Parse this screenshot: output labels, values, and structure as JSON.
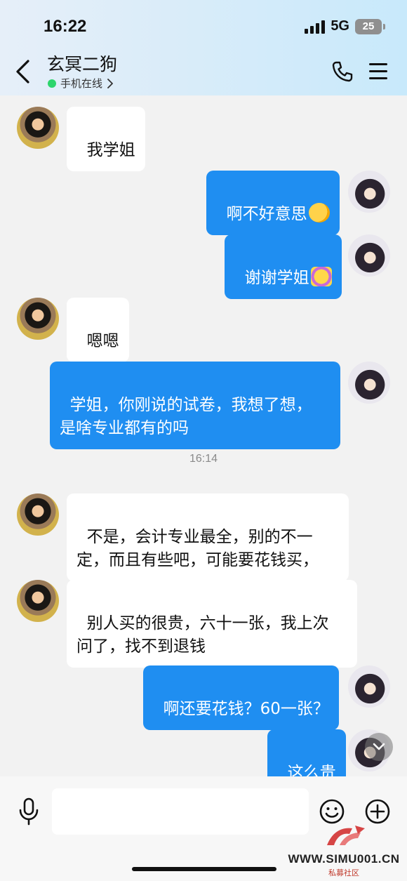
{
  "status_bar": {
    "time": "16:22",
    "network": "5G",
    "battery": "25"
  },
  "header": {
    "contact_name": "玄冥二狗",
    "presence": "手机在线"
  },
  "messages": [
    {
      "side": "in",
      "text": "我学姐"
    },
    {
      "side": "out",
      "text": "啊不好意思",
      "emoji": "laugh-emoji"
    },
    {
      "side": "out",
      "text": "谢谢学姐",
      "emoji": "thanks-emoji"
    },
    {
      "side": "in",
      "text": "嗯嗯"
    },
    {
      "side": "out",
      "text": "学姐，你刚说的试卷，我想了想，\n是啥专业都有的吗"
    },
    {
      "side": "in",
      "text": "不是，会计专业最全，别的不一\n定，而且有些吧，可能要花钱买，"
    },
    {
      "side": "in",
      "text": "别人买的很贵，六十一张，我上次\n问了，找不到退钱"
    },
    {
      "side": "out",
      "text": "啊还要花钱？60一张？"
    },
    {
      "side": "out",
      "text": "这么贵"
    }
  ],
  "timestamp": "16:14",
  "input": {
    "value": "",
    "placeholder": ""
  },
  "watermark": {
    "site": "WWW.SIMU001.CN",
    "subtitle": "私募社区"
  },
  "colors": {
    "outgoing_bubble": "#1f8ef1",
    "incoming_bubble": "#ffffff",
    "online_dot": "#2dd56c"
  }
}
